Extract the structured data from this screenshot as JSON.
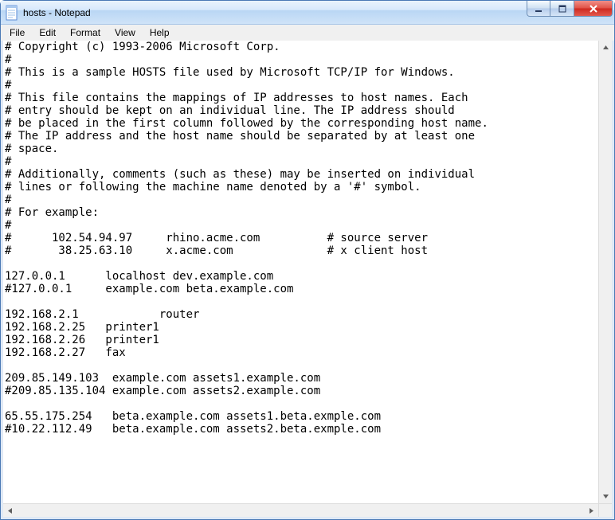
{
  "window": {
    "title": "hosts - Notepad"
  },
  "menu": {
    "file": "File",
    "edit": "Edit",
    "format": "Format",
    "view": "View",
    "help": "Help"
  },
  "document": {
    "text": "# Copyright (c) 1993-2006 Microsoft Corp.\n#\n# This is a sample HOSTS file used by Microsoft TCP/IP for Windows.\n#\n# This file contains the mappings of IP addresses to host names. Each\n# entry should be kept on an individual line. The IP address should\n# be placed in the first column followed by the corresponding host name.\n# The IP address and the host name should be separated by at least one\n# space.\n#\n# Additionally, comments (such as these) may be inserted on individual\n# lines or following the machine name denoted by a '#' symbol.\n#\n# For example:\n#\n#      102.54.94.97     rhino.acme.com          # source server\n#       38.25.63.10     x.acme.com              # x client host\n\n127.0.0.1      localhost dev.example.com\n#127.0.0.1     example.com beta.example.com\n\n192.168.2.1            router\n192.168.2.25   printer1\n192.168.2.26   printer1\n192.168.2.27   fax\n\n209.85.149.103  example.com assets1.example.com\n#209.85.135.104 example.com assets2.example.com\n\n65.55.175.254   beta.example.com assets1.beta.exmple.com\n#10.22.112.49   beta.example.com assets2.beta.exmple.com\n"
  }
}
